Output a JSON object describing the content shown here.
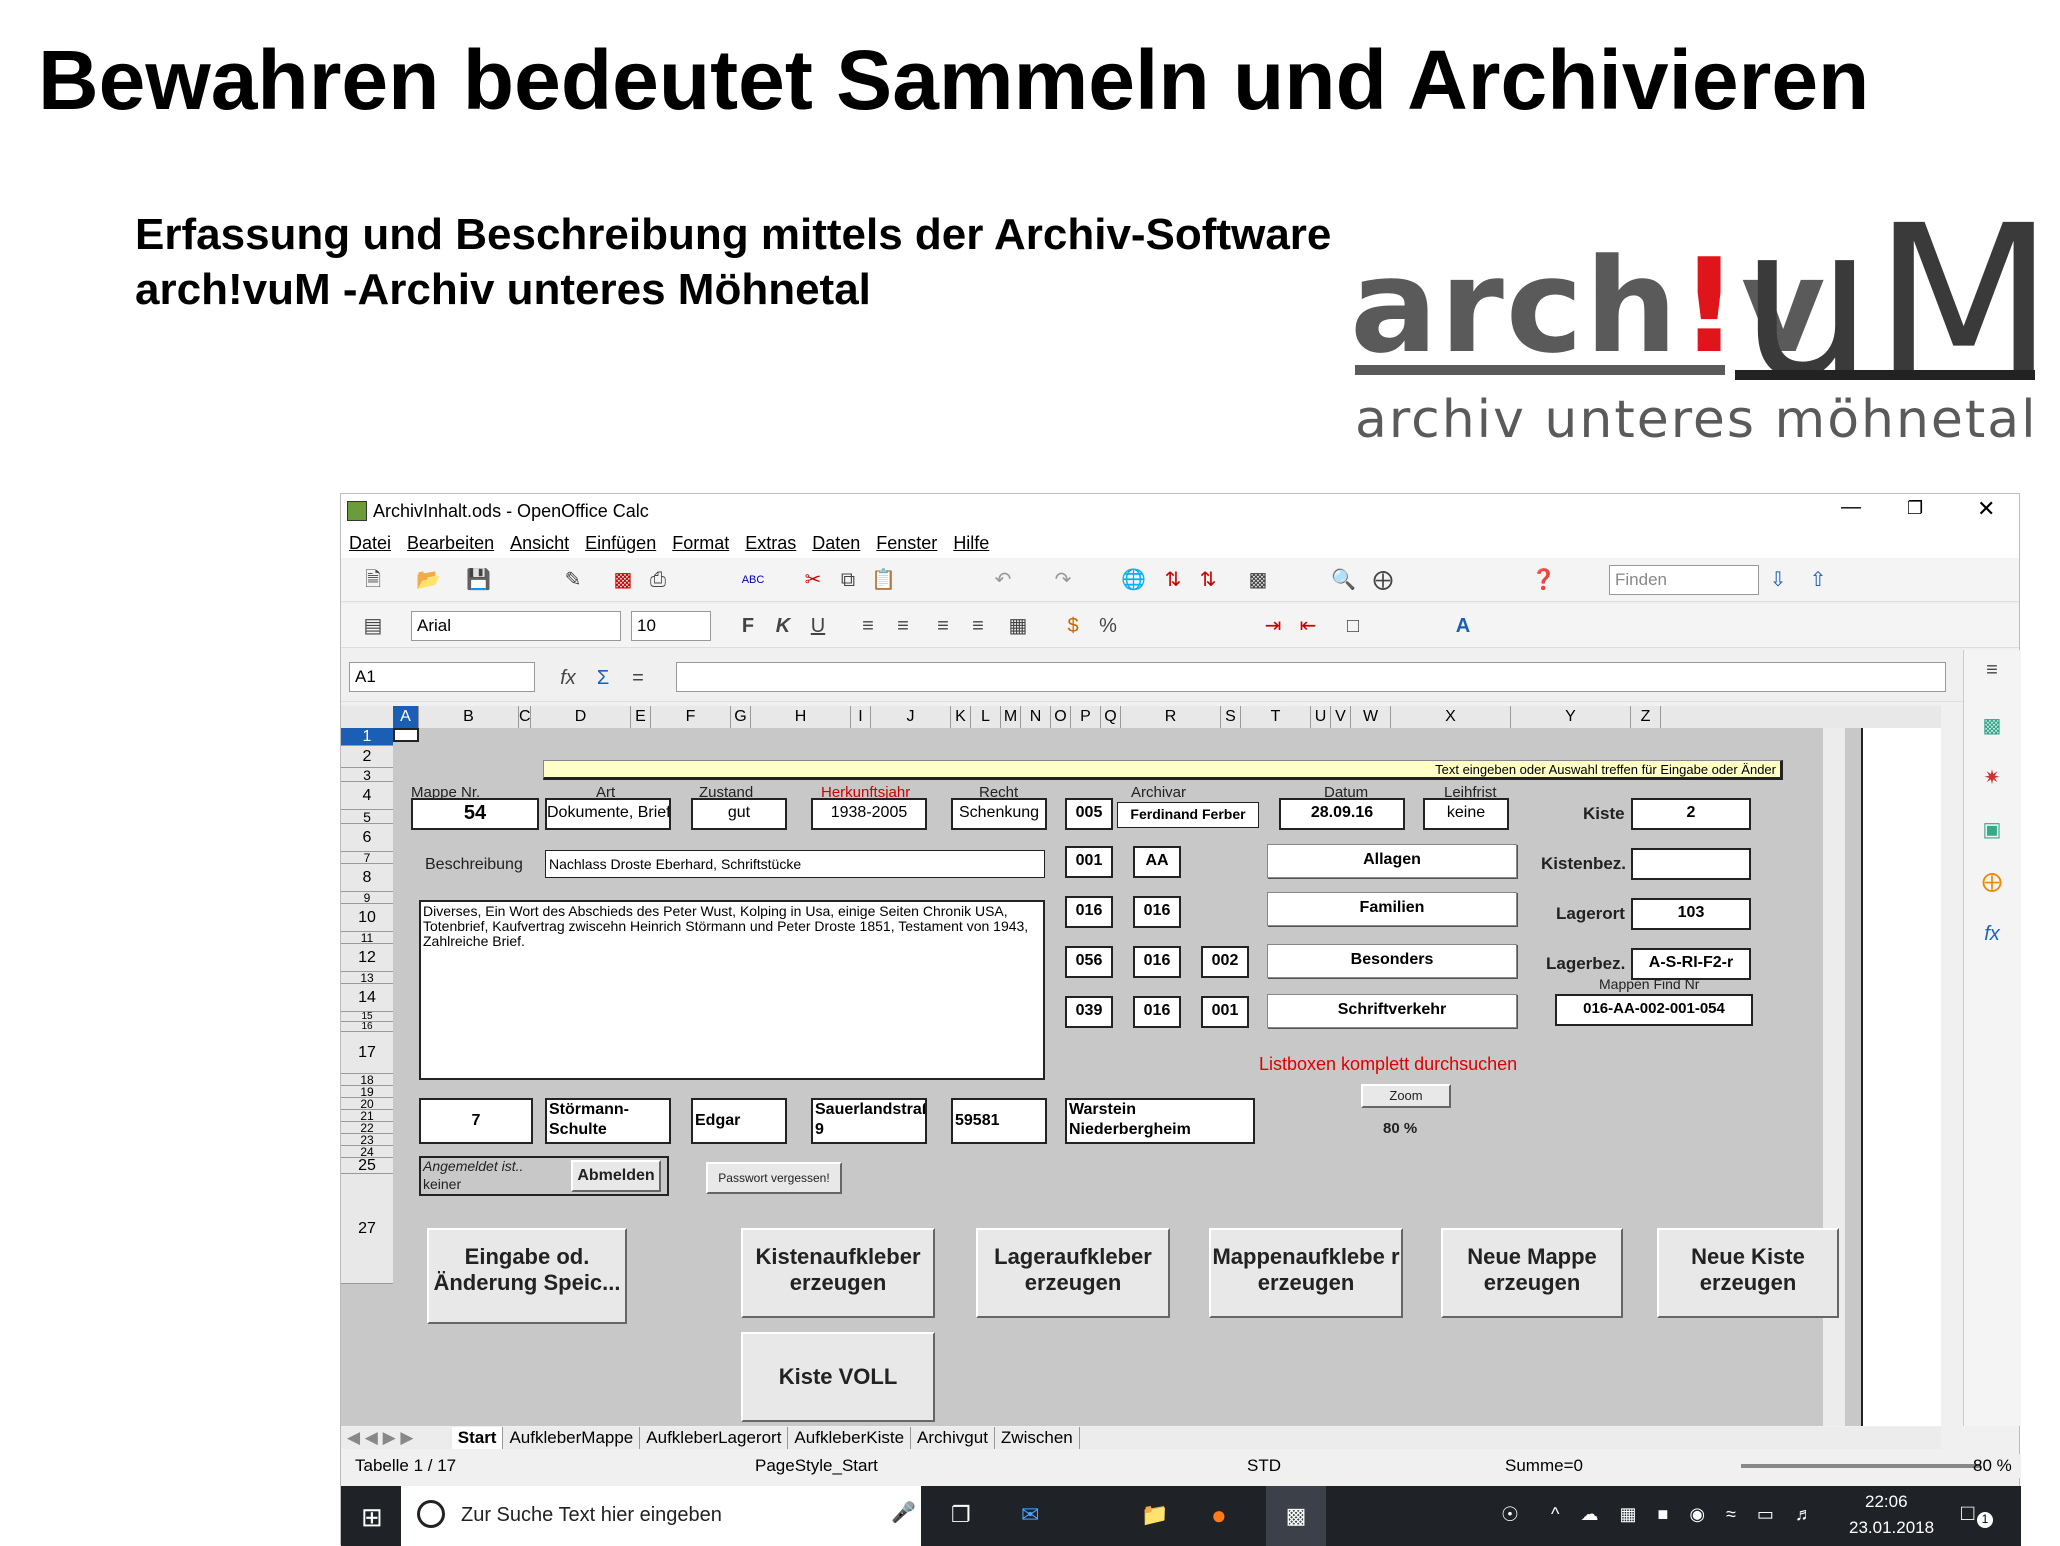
{
  "slide": {
    "title": "Bewahren bedeutet Sammeln und Archivieren",
    "subtitle_line1": "Erfassung und Beschreibung mittels der Archiv-Software",
    "subtitle_line2": "arch!vuM -Archiv unteres Möhnetal"
  },
  "logo": {
    "part1": "arch",
    "bang": "!",
    "part2": "v",
    "big": "uM",
    "motto": "archiv unteres möhnetal"
  },
  "window": {
    "title": "ArchivInhalt.ods - OpenOffice Calc"
  },
  "menu": [
    "Datei",
    "Bearbeiten",
    "Ansicht",
    "Einfügen",
    "Format",
    "Extras",
    "Daten",
    "Fenster",
    "Hilfe"
  ],
  "toolbar": {
    "find_placeholder": "Finden",
    "font": "Arial",
    "size": "10",
    "name_box": "A1",
    "fx": "fx",
    "sum": "Σ",
    "eq": "="
  },
  "columns": [
    "A",
    "B",
    "C",
    "D",
    "E",
    "F",
    "G",
    "H",
    "I",
    "J",
    "K",
    "L",
    "M",
    "N",
    "O",
    "P",
    "Q",
    "R",
    "S",
    "T",
    "U",
    "V",
    "W",
    "X",
    "Y",
    "Z"
  ],
  "rows": [
    "1",
    "2",
    "3",
    "4",
    "5",
    "6",
    "7",
    "8",
    "9",
    "10",
    "11",
    "12",
    "13",
    "14",
    "15",
    "16",
    "17",
    "18",
    "19",
    "20",
    "21",
    "22",
    "23",
    "24",
    "25",
    "27"
  ],
  "form": {
    "hint": "Text eingeben oder Auswahl treffen für Eingabe oder Änder",
    "hdr_mappe": "Mappe Nr.",
    "hdr_art": "Art",
    "hdr_zustand": "Zustand",
    "hdr_herkunft": "Herkunftsjahr",
    "hdr_recht": "Recht",
    "hdr_archivar": "Archivar",
    "hdr_datum": "Datum",
    "hdr_leihfrist": "Leihfrist",
    "mappe": "54",
    "art": "Dokumente, Briefe",
    "zustand": "gut",
    "herkunft": "1938-2005",
    "recht": "Schenkung",
    "archivar_code": "005",
    "archivar": "Ferdinand Ferber",
    "datum": "28.09.16",
    "leihfrist": "keine",
    "kiste_label": "Kiste",
    "kiste": "2",
    "kistenbez_label": "Kistenbez.",
    "kistenbez": "",
    "lagerort_label": "Lagerort",
    "lagerort": "103",
    "lagerbez_label": "Lagerbez.",
    "lagerbez": "A-S-RI-F2-r",
    "mappen_find_label": "Mappen Find Nr",
    "mappen_find": "016-AA-002-001-054",
    "beschreibung_label": "Beschreibung",
    "beschreibung": "Nachlass Droste Eberhard, Schriftstücke",
    "long_text": "Diverses, Ein Wort des Abschieds des Peter Wust, Kolping in Usa, einige Seiten Chronik USA, Totenbrief, Kaufvertrag zwiscehn Heinrich Störmann und Peter Droste 1851, Testament von 1943, Zahlreiche Brief.",
    "codes": [
      [
        "001",
        "AA"
      ],
      [
        "016",
        "016"
      ],
      [
        "056",
        "016",
        "002"
      ],
      [
        "039",
        "016",
        "001"
      ]
    ],
    "cat": [
      "Allagen",
      "Familien",
      "Besonders",
      "Schriftverkehr"
    ],
    "listboxen": "Listboxen komplett durchsuchen",
    "zoom_btn": "Zoom",
    "zoom_pct": "80 %",
    "r17_a": "7",
    "r17_b": "Störmann-Schulte",
    "r17_c": "Edgar",
    "r17_d": "Sauerlandstraße 9",
    "r17_e": "59581",
    "r17_f": "Warstein Niederbergheim",
    "login_label": "Angemeldet ist..",
    "login_user": "keiner",
    "logout": "Abmelden",
    "pw": "Passwort vergessen!",
    "btn1": "Eingabe od. Änderung Speic...",
    "btn2": "Kistenaufkleber erzeugen",
    "btn3": "Lageraufkleber erzeugen",
    "btn4": "Mappenaufklebe r erzeugen",
    "btn5": "Neue Mappe erzeugen",
    "btn6": "Neue Kiste erzeugen",
    "btn7": "Kiste VOLL"
  },
  "tabs": [
    "Start",
    "AufkleberMappe",
    "AufkleberLagerort",
    "AufkleberKiste",
    "Archivgut",
    "Zwischen"
  ],
  "status": {
    "sheet": "Tabelle 1 / 17",
    "style": "PageStyle_Start",
    "mode": "STD",
    "sum": "Summe=0",
    "zoom": "80 %"
  },
  "taskbar": {
    "search": "Zur Suche Text hier eingeben",
    "time": "22:06",
    "date": "23.01.2018",
    "notif": "1"
  }
}
